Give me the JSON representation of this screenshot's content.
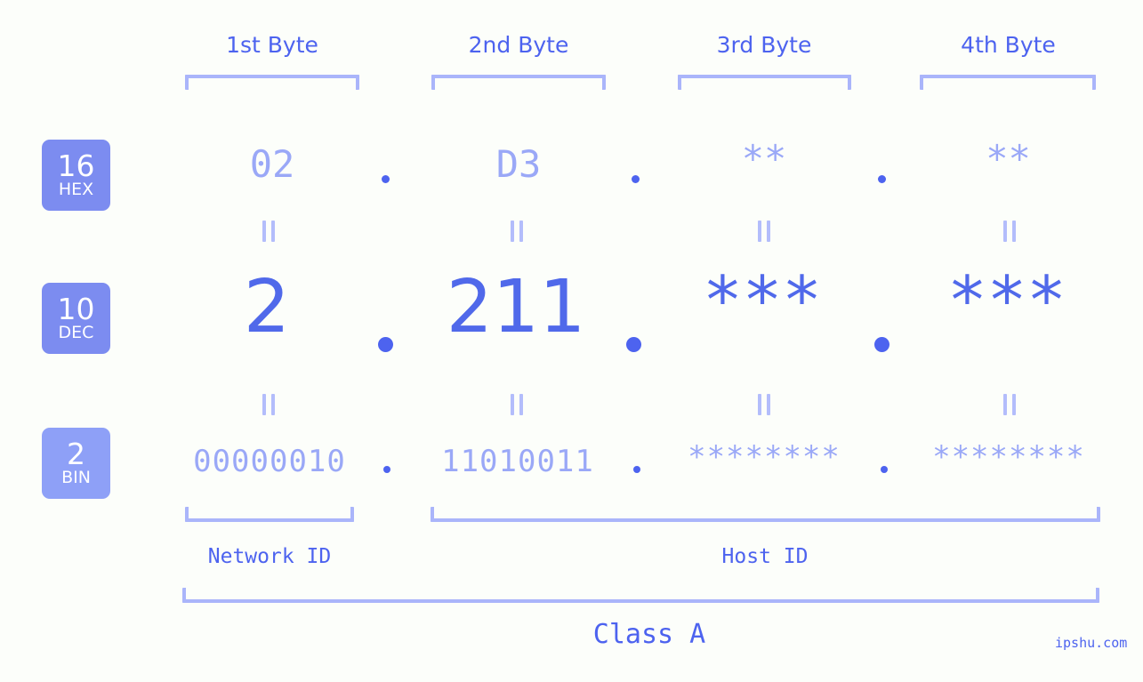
{
  "meta": {
    "background_color": "#fcfefa",
    "accent_color": "#4d63ef",
    "muted_color": "#9aa8f7",
    "badge_color": "#7c8cf0"
  },
  "byte_headers": [
    {
      "label": "1st Byte"
    },
    {
      "label": "2nd Byte"
    },
    {
      "label": "3rd Byte"
    },
    {
      "label": "4th Byte"
    }
  ],
  "radix_badges": [
    {
      "number": "16",
      "name": "HEX"
    },
    {
      "number": "10",
      "name": "DEC"
    },
    {
      "number": "2",
      "name": "BIN"
    }
  ],
  "rows": {
    "hex": {
      "values": [
        "02",
        "D3",
        "**",
        "**"
      ],
      "separators": [
        ".",
        ".",
        "."
      ]
    },
    "dec": {
      "values": [
        "2",
        "211",
        "***",
        "***"
      ],
      "separators": [
        ".",
        ".",
        "."
      ]
    },
    "bin": {
      "values": [
        "00000010",
        "11010011",
        "********",
        "********"
      ],
      "separators": [
        ".",
        ".",
        "."
      ]
    }
  },
  "equals_signs": [
    "=",
    "=",
    "=",
    "=",
    "=",
    "=",
    "=",
    "="
  ],
  "id_sections": [
    {
      "label": "Network ID"
    },
    {
      "label": "Host ID"
    }
  ],
  "class_section": {
    "label": "Class A"
  },
  "watermark": {
    "text": "ipshu.com"
  }
}
